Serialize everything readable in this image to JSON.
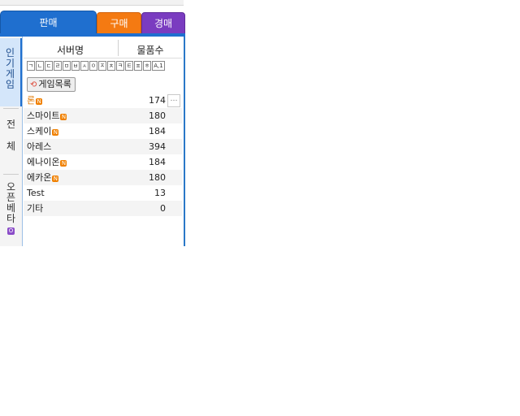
{
  "tabs": {
    "sell": "판매",
    "buy": "구매",
    "auction": "경매"
  },
  "sidebar": {
    "popular": [
      "인",
      "기",
      "게",
      "임"
    ],
    "all": [
      "전",
      "체"
    ],
    "openbeta": [
      "오",
      "픈",
      "베",
      "타"
    ],
    "openbeta_badge": "O"
  },
  "list_header": {
    "server": "서버명",
    "count": "물품수"
  },
  "alphabet": [
    "ㄱ",
    "ㄴ",
    "ㄷ",
    "ㄹ",
    "ㅁ",
    "ㅂ",
    "ㅅ",
    "ㅇ",
    "ㅈ",
    "ㅊ",
    "ㅋ",
    "ㅌ",
    "ㅍ",
    "ㅎ",
    "A,1"
  ],
  "game_list_button": "게임목록",
  "new_badge": "N",
  "rows": [
    {
      "name": "론",
      "count": "174",
      "new": true
    },
    {
      "name": "스마이트",
      "count": "180",
      "new": true
    },
    {
      "name": "스케이",
      "count": "184",
      "new": true
    },
    {
      "name": "아레스",
      "count": "394",
      "new": false
    },
    {
      "name": "에나이온",
      "count": "184",
      "new": true
    },
    {
      "name": "에카온",
      "count": "180",
      "new": true
    },
    {
      "name": "Test",
      "count": "13",
      "new": false
    },
    {
      "name": "기타",
      "count": "0",
      "new": false
    }
  ],
  "scroll_glyph": "…",
  "colors": {
    "sell": "#1f6fcf",
    "buy": "#f47a12",
    "auction": "#7a3cc0",
    "new_badge": "#f08000"
  }
}
